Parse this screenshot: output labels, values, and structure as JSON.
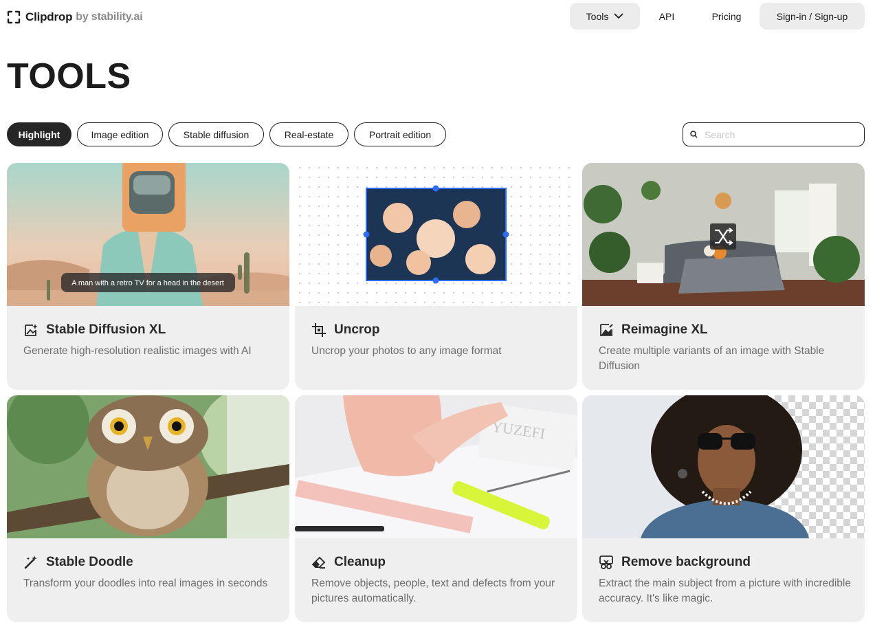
{
  "brand": {
    "name": "Clipdrop",
    "by": "by stability.ai"
  },
  "nav": {
    "tools": "Tools",
    "api": "API",
    "pricing": "Pricing",
    "signin": "Sign-in / Sign-up"
  },
  "page": {
    "title": "TOOLS"
  },
  "filters": [
    "Highlight",
    "Image edition",
    "Stable diffusion",
    "Real-estate",
    "Portrait edition"
  ],
  "search": {
    "placeholder": "Search"
  },
  "cards": [
    {
      "title": "Stable Diffusion XL",
      "description": "Generate high-resolution realistic images with AI",
      "image_caption": "A man with a retro TV for a head in the desert",
      "icon": "image-sparkle-icon"
    },
    {
      "title": "Uncrop",
      "description": "Uncrop your photos to any image format",
      "icon": "crop-icon"
    },
    {
      "title": "Reimagine XL",
      "description": "Create multiple variants of an image with Stable Diffusion",
      "icon": "image-edit-icon"
    },
    {
      "title": "Stable Doodle",
      "description": "Transform your doodles into real images in seconds",
      "icon": "magic-wand-icon"
    },
    {
      "title": "Cleanup",
      "description": "Remove objects, people, text and defects from your pictures automatically.",
      "icon": "eraser-icon"
    },
    {
      "title": "Remove background",
      "description": "Extract the main subject from a picture with incredible accuracy. It's like magic.",
      "icon": "scissors-icon"
    }
  ],
  "colors": {
    "accent": "#2e6cf5",
    "chip_active": "#262626",
    "card_bg": "#efefef"
  }
}
